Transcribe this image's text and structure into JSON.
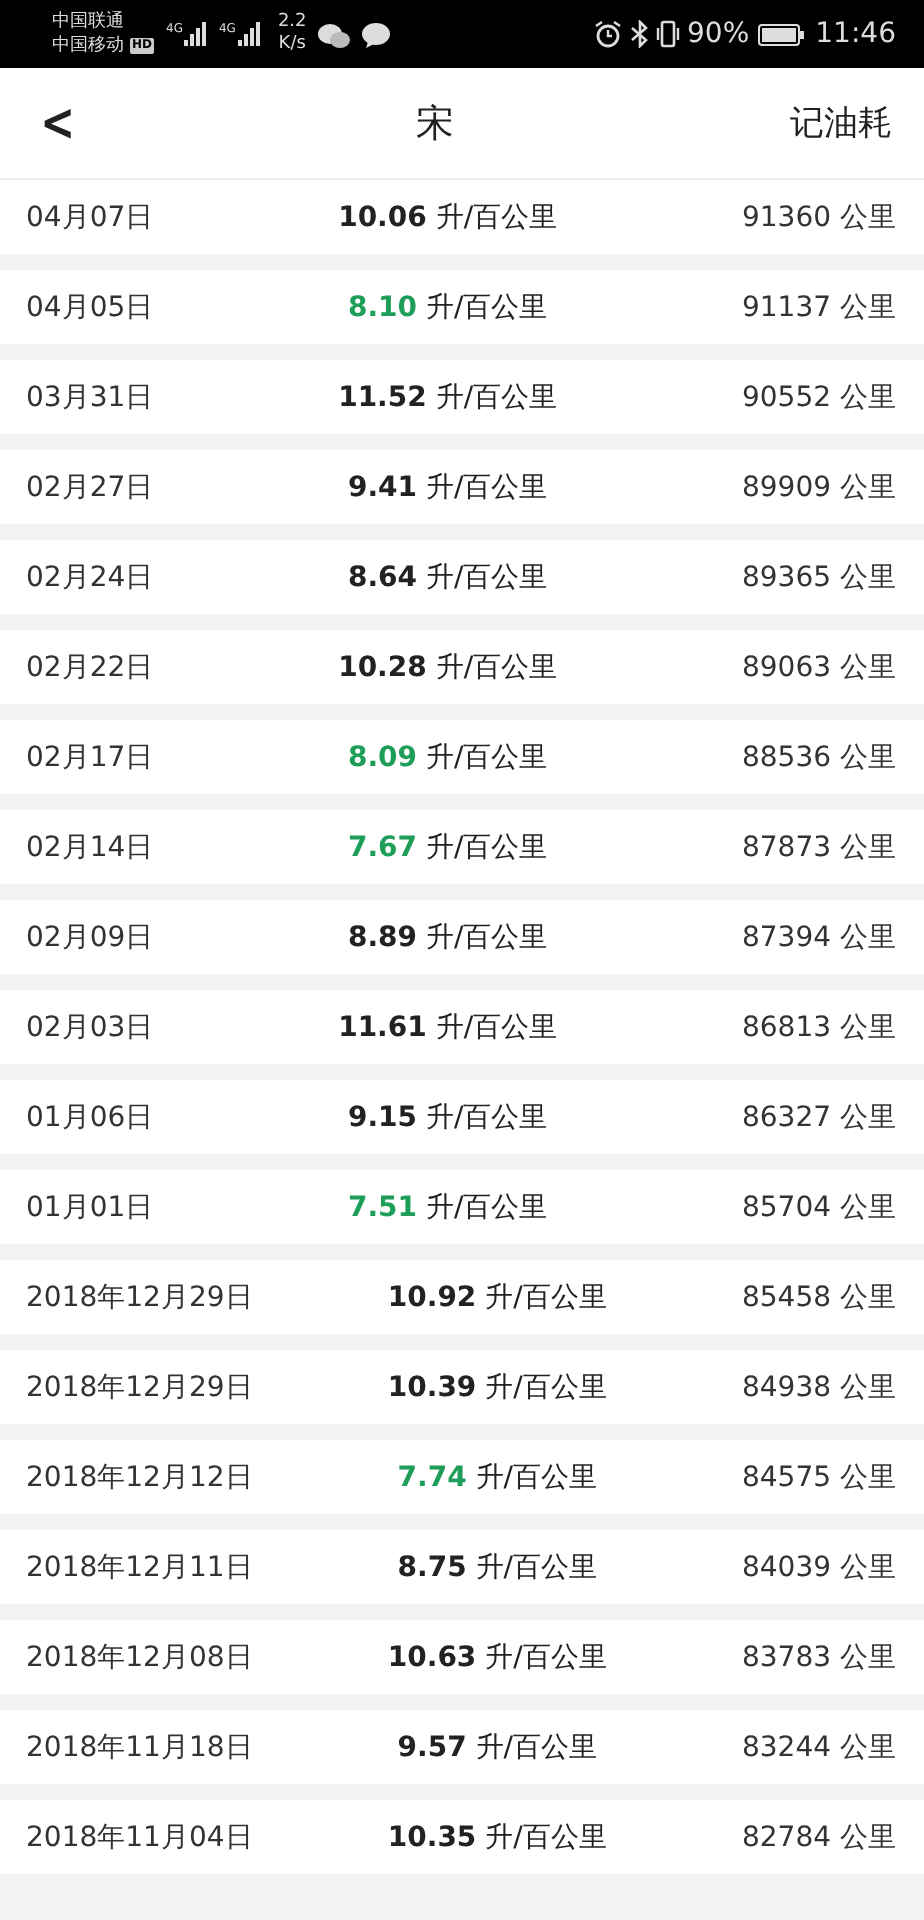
{
  "status_bar": {
    "carriers": [
      "中国联通",
      "中国移动"
    ],
    "hd_badge": "HD",
    "signals": [
      "4G",
      "4G"
    ],
    "speed_value": "2.2",
    "speed_unit": "K/s",
    "battery": "90%",
    "time": "11:46"
  },
  "header": {
    "back": "<",
    "title": "宋",
    "action": "记油耗"
  },
  "records": [
    {
      "date": "04月07日",
      "consumption": "10.06",
      "unit": "升/百公里",
      "mileage": "91360 公里",
      "highlighted": false
    },
    {
      "date": "04月05日",
      "consumption": "8.10",
      "unit": "升/百公里",
      "mileage": "91137 公里",
      "highlighted": true
    },
    {
      "date": "03月31日",
      "consumption": "11.52",
      "unit": "升/百公里",
      "mileage": "90552 公里",
      "highlighted": false
    },
    {
      "date": "02月27日",
      "consumption": "9.41",
      "unit": "升/百公里",
      "mileage": "89909 公里",
      "highlighted": false
    },
    {
      "date": "02月24日",
      "consumption": "8.64",
      "unit": "升/百公里",
      "mileage": "89365 公里",
      "highlighted": false
    },
    {
      "date": "02月22日",
      "consumption": "10.28",
      "unit": "升/百公里",
      "mileage": "89063 公里",
      "highlighted": false
    },
    {
      "date": "02月17日",
      "consumption": "8.09",
      "unit": "升/百公里",
      "mileage": "88536 公里",
      "highlighted": true
    },
    {
      "date": "02月14日",
      "consumption": "7.67",
      "unit": "升/百公里",
      "mileage": "87873 公里",
      "highlighted": true
    },
    {
      "date": "02月09日",
      "consumption": "8.89",
      "unit": "升/百公里",
      "mileage": "87394 公里",
      "highlighted": false
    },
    {
      "date": "02月03日",
      "consumption": "11.61",
      "unit": "升/百公里",
      "mileage": "86813 公里",
      "highlighted": false
    },
    {
      "date": "01月06日",
      "consumption": "9.15",
      "unit": "升/百公里",
      "mileage": "86327 公里",
      "highlighted": false
    },
    {
      "date": "01月01日",
      "consumption": "7.51",
      "unit": "升/百公里",
      "mileage": "85704 公里",
      "highlighted": true
    },
    {
      "date": "2018年12月29日",
      "consumption": "10.92",
      "unit": "升/百公里",
      "mileage": "85458 公里",
      "highlighted": false
    },
    {
      "date": "2018年12月29日",
      "consumption": "10.39",
      "unit": "升/百公里",
      "mileage": "84938 公里",
      "highlighted": false
    },
    {
      "date": "2018年12月12日",
      "consumption": "7.74",
      "unit": "升/百公里",
      "mileage": "84575 公里",
      "highlighted": true
    },
    {
      "date": "2018年12月11日",
      "consumption": "8.75",
      "unit": "升/百公里",
      "mileage": "84039 公里",
      "highlighted": false
    },
    {
      "date": "2018年12月08日",
      "consumption": "10.63",
      "unit": "升/百公里",
      "mileage": "83783 公里",
      "highlighted": false
    },
    {
      "date": "2018年11月18日",
      "consumption": "9.57",
      "unit": "升/百公里",
      "mileage": "83244 公里",
      "highlighted": false
    },
    {
      "date": "2018年11月04日",
      "consumption": "10.35",
      "unit": "升/百公里",
      "mileage": "82784 公里",
      "highlighted": false
    }
  ]
}
